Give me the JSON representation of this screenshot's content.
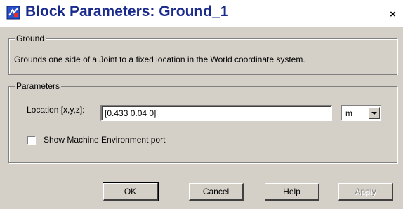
{
  "window": {
    "title": "Block Parameters: Ground_1",
    "close_glyph": "×"
  },
  "ground_group": {
    "legend": "Ground",
    "description": "Grounds one side of a Joint to a fixed location in the World coordinate system."
  },
  "parameters_group": {
    "legend": "Parameters",
    "location_label": "Location [x,y,z]:",
    "location_value": "[0.433 0.04 0]",
    "units_value": "m",
    "show_port_label": "Show Machine Environment port",
    "show_port_checked": false
  },
  "buttons": {
    "ok": "OK",
    "cancel": "Cancel",
    "help": "Help",
    "apply": "Apply"
  },
  "icons": {
    "title_icon": "simulink-block-icon",
    "close_icon": "close-icon"
  },
  "colors": {
    "title_text": "#1a2a8c",
    "dialog_bg": "#d4d0c8"
  }
}
